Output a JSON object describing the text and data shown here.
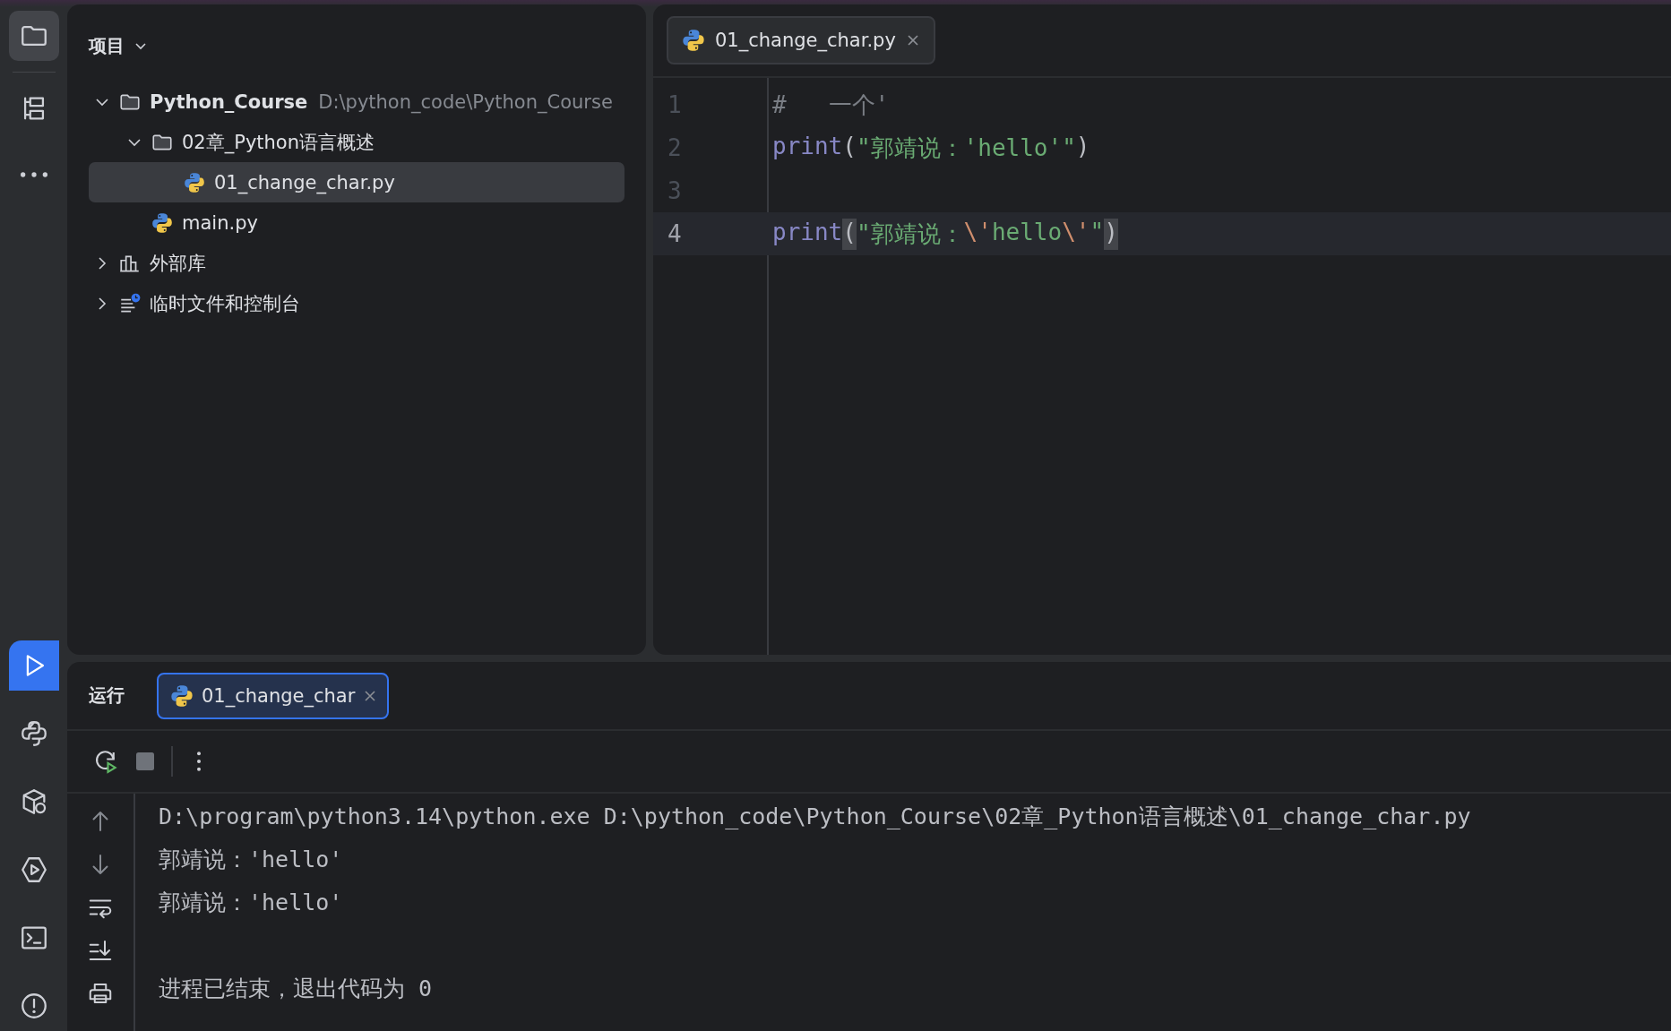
{
  "toolbar": {
    "top": [
      {
        "kind": "folder",
        "selected": true
      },
      {
        "kind": "structure",
        "selected": false
      },
      {
        "kind": "more",
        "selected": false
      }
    ],
    "bottom": [
      {
        "kind": "run",
        "selected": true
      },
      {
        "kind": "python",
        "selected": false
      },
      {
        "kind": "packages",
        "selected": false
      },
      {
        "kind": "services",
        "selected": false
      },
      {
        "kind": "terminal",
        "selected": false
      },
      {
        "kind": "problems",
        "selected": false
      }
    ]
  },
  "project": {
    "title": "项目",
    "tree": [
      {
        "label": "Python_Course",
        "hint": "D:\\python_code\\Python_Course",
        "kind": "folder",
        "expanded": true,
        "selected": false,
        "children": [
          {
            "label": "02章_Python语言概述",
            "kind": "folder",
            "expanded": true,
            "selected": false,
            "children": [
              {
                "label": "01_change_char.py",
                "kind": "python",
                "selected": true
              }
            ]
          },
          {
            "label": "main.py",
            "kind": "python",
            "selected": false
          }
        ]
      },
      {
        "label": "外部库",
        "kind": "library",
        "expanded": false,
        "selected": false
      },
      {
        "label": "临时文件和控制台",
        "kind": "scratch",
        "expanded": false,
        "selected": false
      }
    ]
  },
  "editor": {
    "tabs": [
      {
        "label": "01_change_char.py",
        "selected": true
      }
    ],
    "lines": [
      {
        "number": "1",
        "current": false,
        "tokens": [
          {
            "kind": "comment",
            "text": "#   一个'"
          }
        ]
      },
      {
        "number": "2",
        "current": false,
        "tokens": [
          {
            "kind": "keyword",
            "text": "print"
          },
          {
            "kind": "plain",
            "text": "("
          },
          {
            "kind": "string",
            "text": "\"郭靖说：'hello'\""
          },
          {
            "kind": "plain",
            "text": ")"
          }
        ]
      },
      {
        "number": "3",
        "current": false
      },
      {
        "number": "4",
        "current": true,
        "tokens": [
          {
            "kind": "keyword",
            "text": "print"
          },
          {
            "kind": "plain",
            "text": "(",
            "matched": true
          },
          {
            "kind": "string",
            "text": "\"郭靖说："
          },
          {
            "kind": "escape",
            "text": "\\'"
          },
          {
            "kind": "string",
            "text": "hello"
          },
          {
            "kind": "escape",
            "text": "\\'"
          },
          {
            "kind": "string",
            "text": "\""
          },
          {
            "kind": "plain",
            "text": ")",
            "matched": true
          }
        ]
      }
    ]
  },
  "run": {
    "title": "运行",
    "tabs": [
      {
        "label": "01_change_char",
        "selected": true
      }
    ],
    "actions": [
      {
        "kind": "rerun"
      },
      {
        "kind": "stop"
      },
      {
        "kind": "divider"
      },
      {
        "kind": "more"
      }
    ],
    "side": [
      {
        "kind": "up"
      },
      {
        "kind": "down"
      },
      {
        "kind": "wrap"
      },
      {
        "kind": "scroll-end"
      },
      {
        "kind": "print"
      }
    ],
    "console": [
      {
        "kind": "text",
        "text": "D:\\program\\python3.14\\python.exe D:\\python_code\\Python_Course\\02章_Python语言概述\\01_change_char.py"
      },
      {
        "kind": "text",
        "text": "郭靖说：'hello'"
      },
      {
        "kind": "text",
        "text": "郭靖说：'hello'"
      },
      {
        "kind": "blank"
      },
      {
        "kind": "text",
        "text": "进程已结束，退出代码为 0"
      }
    ]
  }
}
